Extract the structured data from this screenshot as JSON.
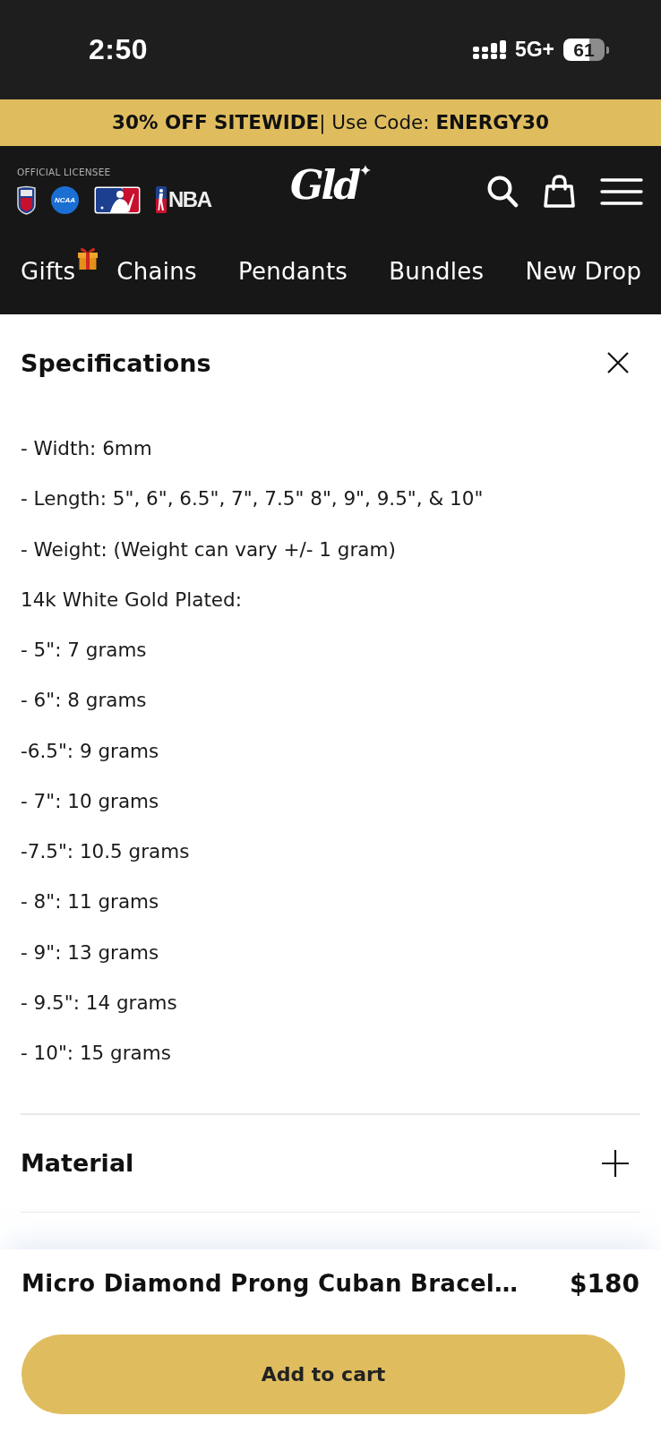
{
  "status_bar": {
    "time": "2:50",
    "network": "5G+",
    "battery": "61"
  },
  "promo_banner": {
    "text": "**30% OFF SITEWIDE**| Use Code: **ENERGY30**"
  },
  "header": {
    "licensee_label": "OFFICIAL LICENSEE",
    "league_logos": [
      {
        "kind": "shield"
      },
      {
        "kind": "disc",
        "text": "NCAA"
      },
      {
        "kind": "batter"
      },
      {
        "kind": "wordmark",
        "text": "NBA"
      }
    ],
    "logo": "Gld"
  },
  "nav": [
    {
      "label": "Gifts",
      "gift_badge": true
    },
    {
      "label": "Chains",
      "gift_badge": false
    },
    {
      "label": "Pendants",
      "gift_badge": false
    },
    {
      "label": "Bundles",
      "gift_badge": false
    },
    {
      "label": "New Drop",
      "gift_badge": false
    }
  ],
  "accordion": [
    {
      "title": "Specifications",
      "expanded": true,
      "lines": [
        "- Width: 6mm",
        "- Length: 5\", 6\", 6.5\", 7\", 7.5\" 8\", 9\", 9.5\", & 10\"",
        "- Weight: (Weight can vary +/- 1 gram)",
        "14k White Gold Plated:",
        "- 5\": 7 grams",
        "- 6\": 8 grams",
        "-6.5\": 9 grams",
        "- 7\": 10 grams",
        "-7.5\": 10.5 grams",
        "- 8\": 11 grams",
        "- 9\": 13 grams",
        "- 9.5\": 14 grams",
        "- 10\": 15 grams"
      ]
    },
    {
      "title": "Material",
      "expanded": false
    }
  ],
  "purchase_bar": {
    "product_title": "Micro Diamond Prong Cuban Bracel…",
    "price": "$180",
    "button": "Add to cart"
  }
}
